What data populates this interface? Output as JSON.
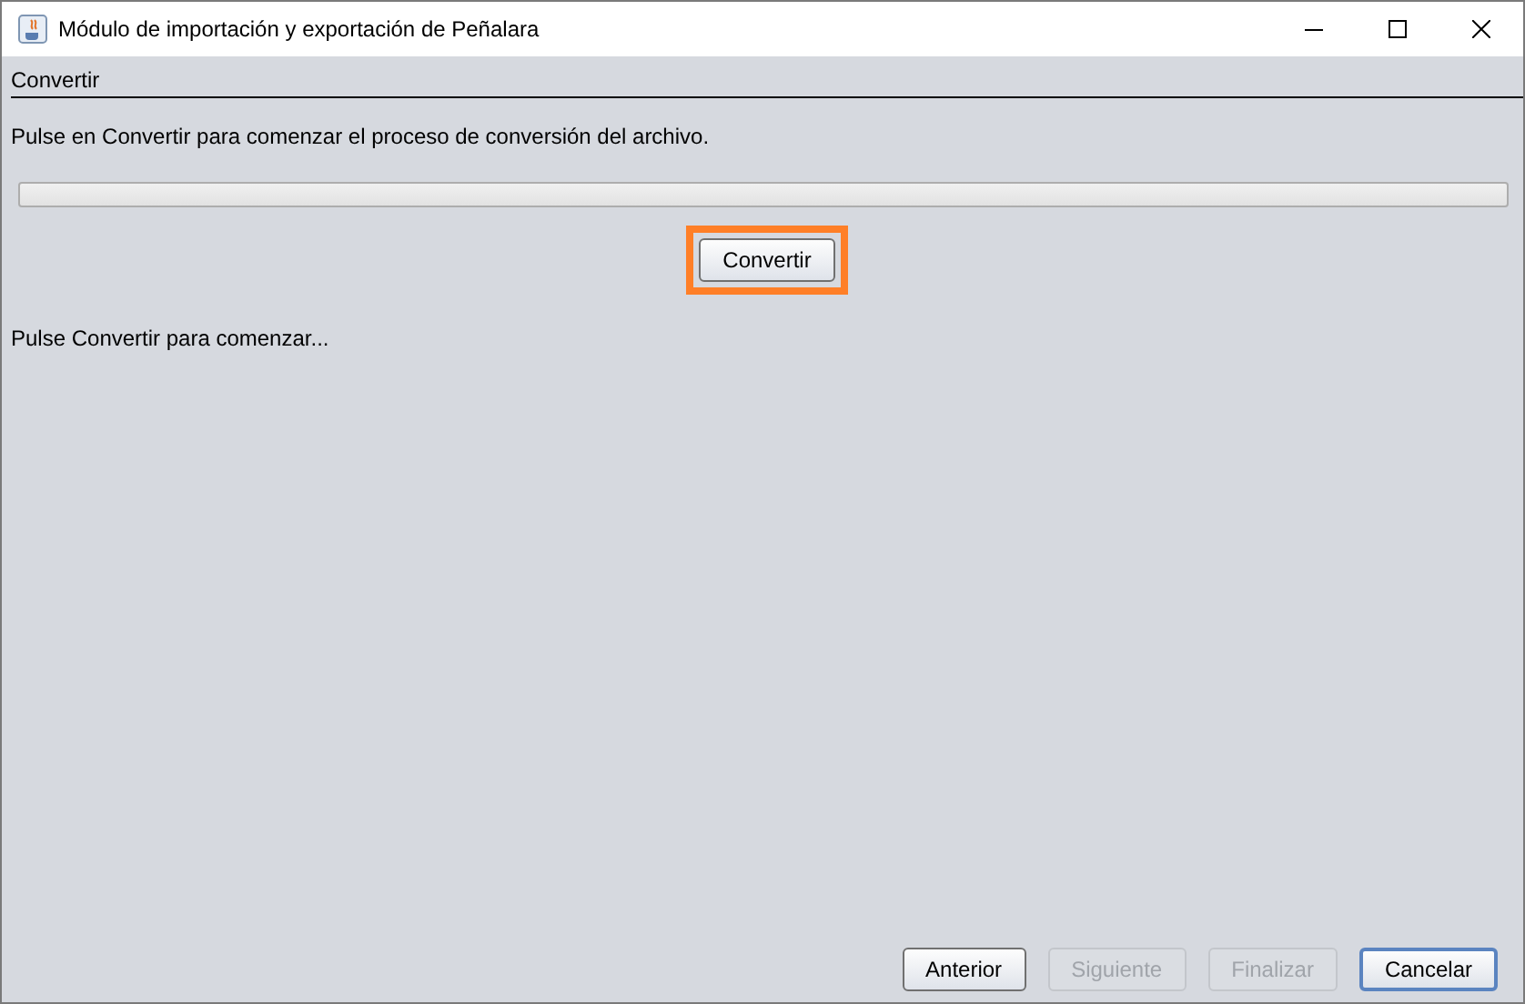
{
  "window": {
    "title": "Módulo de importación y exportación de Peñalara"
  },
  "section_title": "Convertir",
  "instruction": "Pulse en Convertir para comenzar el proceso de conversión del archivo.",
  "progress": {
    "level": 0
  },
  "convert_button": {
    "label": "Convertir",
    "highlighted": true
  },
  "status": "Pulse Convertir para comenzar...",
  "buttons": [
    {
      "label": "Anterior",
      "disabled": false,
      "focused": false
    },
    {
      "label": "Siguiente",
      "disabled": true,
      "focused": false
    },
    {
      "label": "Finalizar",
      "disabled": true,
      "focused": false
    },
    {
      "label": "Cancelar",
      "disabled": false,
      "focused": true
    }
  ]
}
